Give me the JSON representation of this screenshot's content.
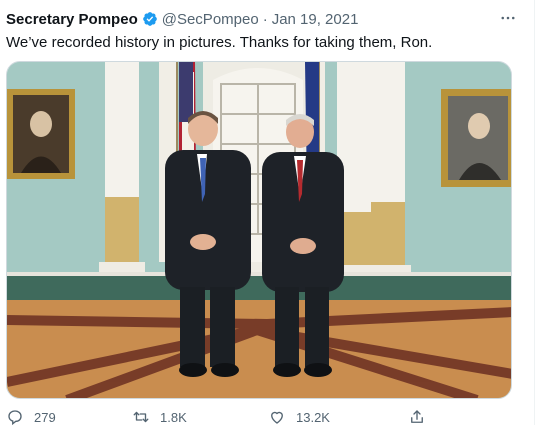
{
  "tweet": {
    "display_name": "Secretary Pompeo",
    "handle": "@SecPompeo",
    "separator": "·",
    "date": "Jan 19, 2021",
    "text": "We’ve recorded history in pictures. Thanks for taking them, Ron.",
    "media_alt": "Two men in dark suits standing in a formal room with flags and portraits",
    "more_icon": "more-horizontal-icon",
    "verified_icon": "verified-badge-icon"
  },
  "actions": {
    "reply_count": "279",
    "retweet_count": "1.8K",
    "like_count": "13.2K",
    "reply_icon": "reply-icon",
    "retweet_icon": "retweet-icon",
    "like_icon": "heart-icon",
    "share_icon": "share-icon"
  },
  "colors": {
    "text_primary": "#0f1419",
    "text_secondary": "#536471",
    "verified_blue": "#1d9bf0",
    "border": "#cfd9de"
  }
}
